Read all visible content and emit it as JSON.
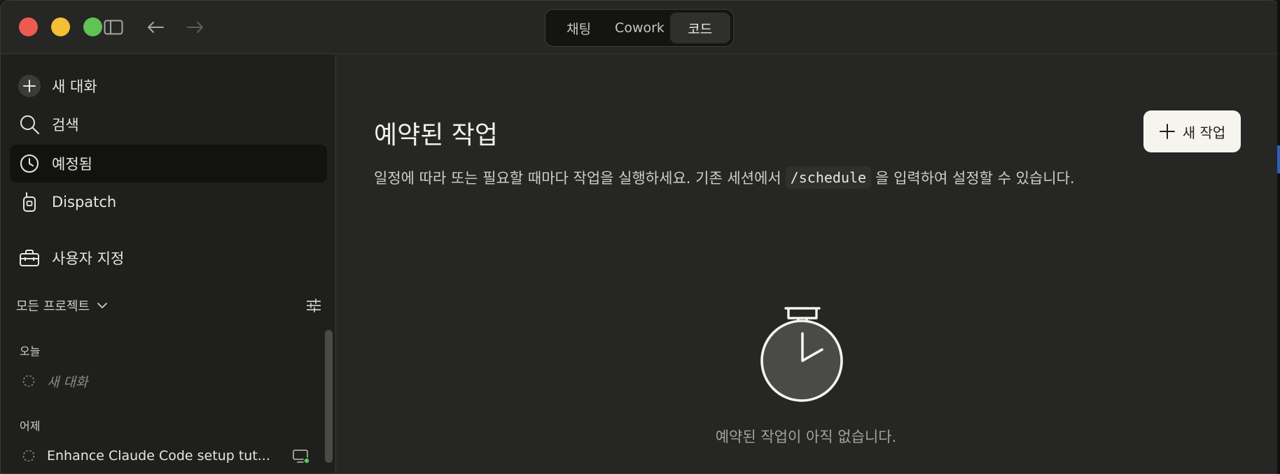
{
  "titlebar": {
    "tabs": [
      {
        "label": "채팅"
      },
      {
        "label": "Cowork"
      },
      {
        "label": "코드",
        "active": true
      }
    ]
  },
  "sidebar": {
    "nav": [
      {
        "label": "새 대화",
        "icon": "plus-circle-icon"
      },
      {
        "label": "검색",
        "icon": "search-icon"
      },
      {
        "label": "예정됨",
        "icon": "clock-icon",
        "active": true
      },
      {
        "label": "Dispatch",
        "icon": "walkie-talkie-icon"
      },
      {
        "label": "사용자 지정",
        "icon": "toolbox-icon"
      }
    ],
    "projects_label": "모든 프로젝트",
    "groups": [
      {
        "label": "오늘",
        "items": [
          {
            "title": "새 대화",
            "placeholder": true
          }
        ]
      },
      {
        "label": "어제",
        "items": [
          {
            "title": "Enhance Claude Code setup tut...",
            "device_status": "online"
          }
        ]
      }
    ]
  },
  "main": {
    "title": "예약된 작업",
    "new_task_label": "새 작업",
    "desc_before": "일정에 따라 또는 필요할 때마다 작업을 실행하세요. 기존 세션에서",
    "desc_code": "/schedule",
    "desc_after": "을 입력하여 설정할 수 있습니다.",
    "empty_text": "예약된 작업이 아직 없습니다."
  },
  "colors": {
    "background": "#262625",
    "sidebar": "#1f1f1e",
    "accent_button": "#f5f4ef",
    "traffic_red": "#ee5a52",
    "traffic_yellow": "#f4bf34",
    "traffic_green": "#5fc454",
    "status_online": "#5fc454"
  }
}
